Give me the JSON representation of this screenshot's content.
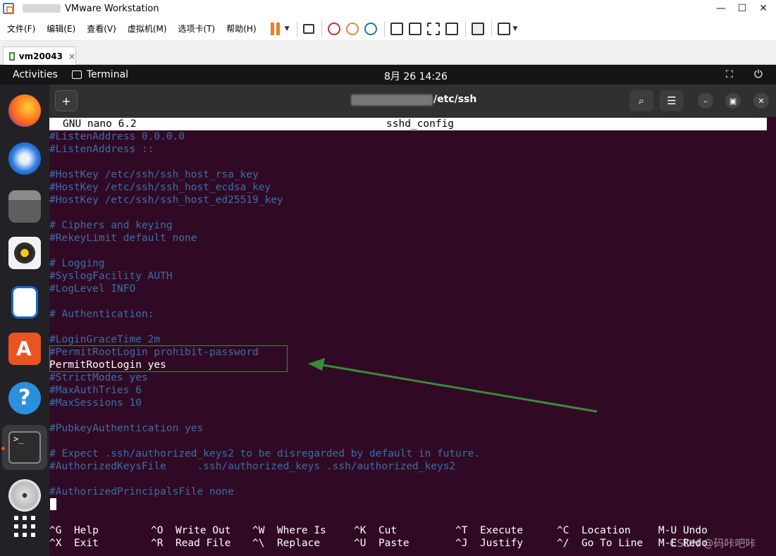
{
  "vmware": {
    "title": "VMware Workstation",
    "menu": [
      "文件(F)",
      "编辑(E)",
      "查看(V)",
      "虚拟机(M)",
      "选项卡(T)",
      "帮助(H)"
    ],
    "tab_label": "vm20043",
    "tab_close": "×",
    "window_controls": [
      "—",
      "☐",
      "✕"
    ]
  },
  "gnome": {
    "activities": "Activities",
    "app": "Terminal",
    "clock": "8月 26  14:26"
  },
  "terminal": {
    "path": "/etc/ssh",
    "new_tab": "+",
    "search": "⌕",
    "menu": "☰",
    "minimize": "–",
    "maximize": "▣",
    "close": "✕"
  },
  "nano": {
    "version": "GNU nano 6.2",
    "filename": "sshd_config",
    "lines": [
      {
        "text": "#ListenAddress 0.0.0.0",
        "comment": true
      },
      {
        "text": "#ListenAddress ::",
        "comment": true
      },
      {
        "text": "",
        "comment": true
      },
      {
        "text": "#HostKey /etc/ssh/ssh_host_rsa_key",
        "comment": true
      },
      {
        "text": "#HostKey /etc/ssh/ssh_host_ecdsa_key",
        "comment": true
      },
      {
        "text": "#HostKey /etc/ssh/ssh_host_ed25519_key",
        "comment": true
      },
      {
        "text": "",
        "comment": true
      },
      {
        "text": "# Ciphers and keying",
        "comment": true
      },
      {
        "text": "#RekeyLimit default none",
        "comment": true
      },
      {
        "text": "",
        "comment": true
      },
      {
        "text": "# Logging",
        "comment": true
      },
      {
        "text": "#SyslogFacility AUTH",
        "comment": true
      },
      {
        "text": "#LogLevel INFO",
        "comment": true
      },
      {
        "text": "",
        "comment": true
      },
      {
        "text": "# Authentication:",
        "comment": true
      },
      {
        "text": "",
        "comment": true
      },
      {
        "text": "#LoginGraceTime 2m",
        "comment": true
      },
      {
        "text": "#PermitRootLogin prohibit-password",
        "comment": true
      },
      {
        "text": "PermitRootLogin yes",
        "comment": false
      },
      {
        "text": "#StrictModes yes",
        "comment": true
      },
      {
        "text": "#MaxAuthTries 6",
        "comment": true
      },
      {
        "text": "#MaxSessions 10",
        "comment": true
      },
      {
        "text": "",
        "comment": true
      },
      {
        "text": "#PubkeyAuthentication yes",
        "comment": true
      },
      {
        "text": "",
        "comment": true
      },
      {
        "text": "# Expect .ssh/authorized_keys2 to be disregarded by default in future.",
        "comment": true
      },
      {
        "text": "#AuthorizedKeysFile     .ssh/authorized_keys .ssh/authorized_keys2",
        "comment": true
      },
      {
        "text": "",
        "comment": true
      },
      {
        "text": "#AuthorizedPrincipalsFile none",
        "comment": true
      }
    ],
    "shortcuts": [
      {
        "key": "^G",
        "label": "Help"
      },
      {
        "key": "^X",
        "label": "Exit"
      },
      {
        "key": "^O",
        "label": "Write Out"
      },
      {
        "key": "^R",
        "label": "Read File"
      },
      {
        "key": "^W",
        "label": "Where Is"
      },
      {
        "key": "^\\",
        "label": "Replace"
      },
      {
        "key": "^K",
        "label": "Cut"
      },
      {
        "key": "^U",
        "label": "Paste"
      },
      {
        "key": "^T",
        "label": "Execute"
      },
      {
        "key": "^J",
        "label": "Justify"
      },
      {
        "key": "^C",
        "label": "Location"
      },
      {
        "key": "^/",
        "label": "Go To Line"
      },
      {
        "key": "M-U",
        "label": "Undo"
      },
      {
        "key": "M-E",
        "label": "Redo"
      }
    ]
  },
  "watermark": "CSDN @码咔吧咔",
  "colors": {
    "terminal_bg": "#300a24",
    "comment": "#3b6ea8",
    "highlight": "#3a8b3a",
    "accent": "#e95420"
  }
}
